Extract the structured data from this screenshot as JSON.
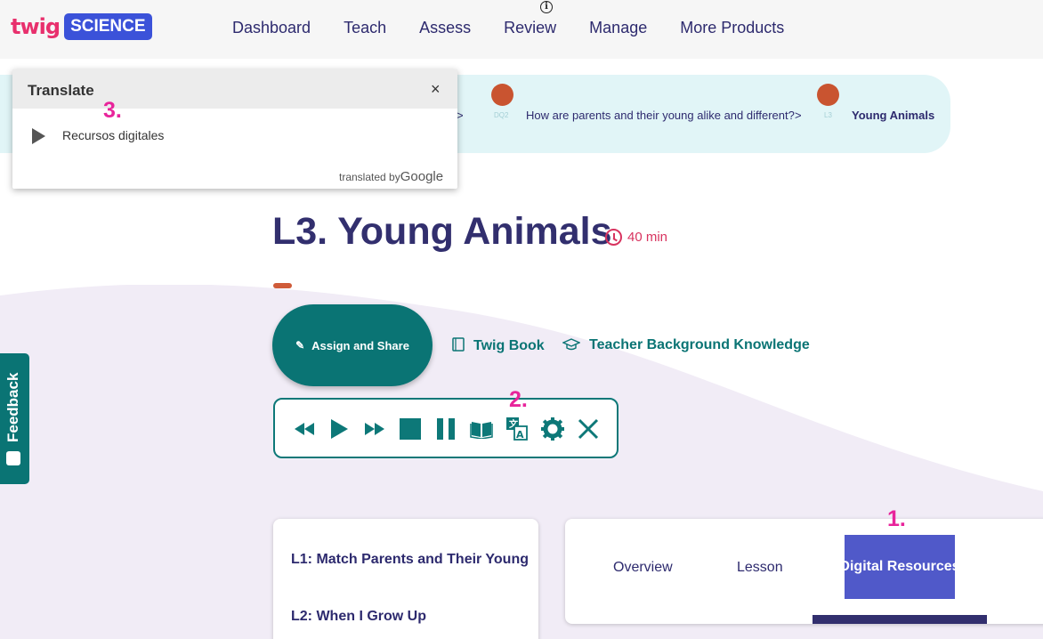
{
  "header": {
    "logo_twig": "twig",
    "logo_science": "SCIENCE",
    "nav": [
      {
        "label": "Dashboard"
      },
      {
        "label": "Teach"
      },
      {
        "label": "Assess"
      },
      {
        "label": "Review"
      },
      {
        "label": "Manage"
      },
      {
        "label": "More Products"
      }
    ]
  },
  "breadcrumb": {
    "item1": {
      "code": "DQ2",
      "label": "How are parents and their young alike and different?"
    },
    "item2": {
      "code": "L3",
      "label": "Young Animals"
    },
    "separator": ">"
  },
  "lesson": {
    "title": "L3. Young Animals",
    "duration": "40 min"
  },
  "actions": {
    "assign": "Assign and Share",
    "twig_book": "Twig Book",
    "teacher_bg": "Teacher Background Knowledge"
  },
  "toolbar": {
    "buttons": [
      "rewind-icon",
      "play-icon",
      "fast-forward-icon",
      "stop-icon",
      "pause-icon",
      "book-icon",
      "translate-icon",
      "gear-icon",
      "close-icon"
    ]
  },
  "feedback": {
    "label": "Feedback"
  },
  "lessons_list": [
    {
      "label": "L1: Match Parents and Their Young"
    },
    {
      "label": "L2: When I Grow Up"
    }
  ],
  "tabs": {
    "overview": "Overview",
    "lesson": "Lesson",
    "digital_resources": "Digital Resources"
  },
  "steps": {
    "one": "1.",
    "two": "2.",
    "three": "3."
  },
  "translate_popup": {
    "title": "Translate",
    "close": "×",
    "text": "Recursos digitales",
    "credit_prefix": "translated by",
    "credit_brand": "Google"
  },
  "colors": {
    "teal": "#0a7474",
    "navy": "#2d2a6e",
    "accent_pink": "#e8249b",
    "tab_active": "#5059c9",
    "logo_blue": "#3b52d9"
  }
}
